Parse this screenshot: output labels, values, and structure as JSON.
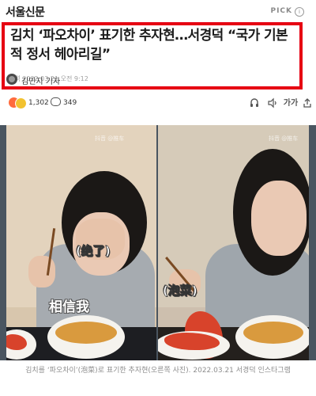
{
  "header": {
    "publisher": "서울신문",
    "pick_label": "PICK",
    "pick_info_icon": "info-icon"
  },
  "article": {
    "headline": "김치 ‘파오차이’ 표기한 추자현…서경덕 “국가 기본적 정서 헤아리길”",
    "meta": "입력 2022.03.21 오전 9:12",
    "author": "김민지 기자",
    "reaction_count": "1,302",
    "comment_count": "349",
    "image_caption": "김치를 ‘파오차이’(泡菜)로 표기한 추자현(오른쪽 사진). 2022.03.21 서경덕 인스타그램"
  },
  "toolbar": {
    "icons": [
      "listen-icon",
      "volume-icon",
      "font-size-icon",
      "share-icon"
    ],
    "font_size_label": "가가"
  },
  "photo": {
    "left_bubble_text": "(绝了)",
    "left_big_text": "相信我",
    "right_bubble_text": "(泡菜)",
    "watermark": "抖音 @推车"
  },
  "colors": {
    "highlight_border": "#e60012",
    "meta_gray": "#a0a0a0"
  }
}
